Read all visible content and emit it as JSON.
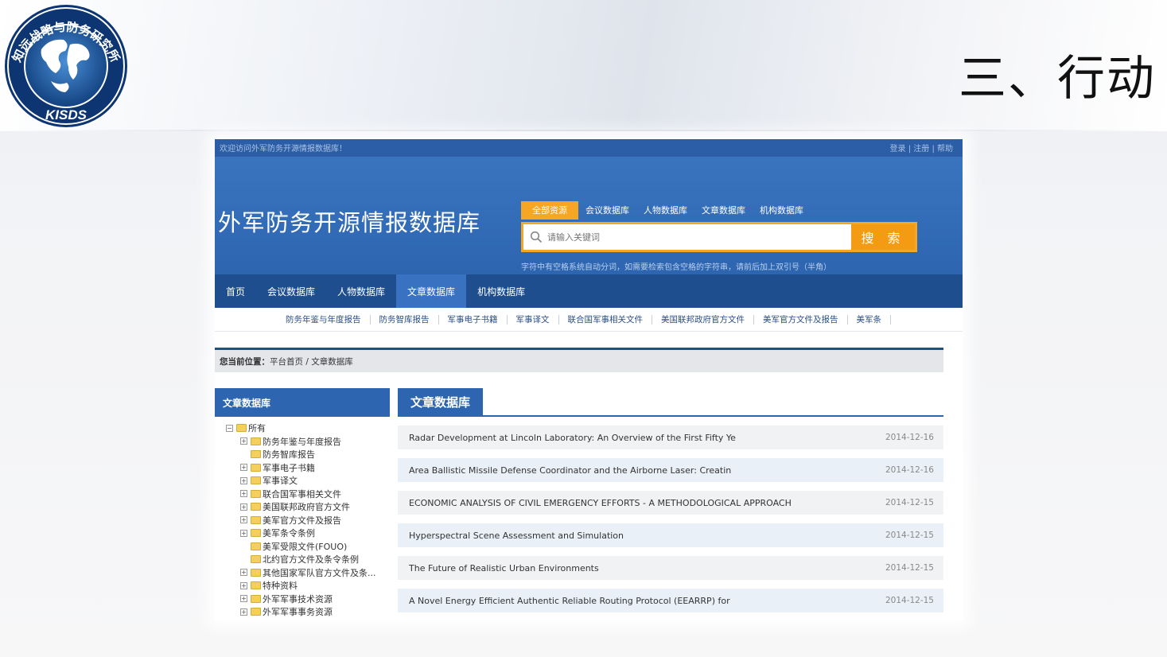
{
  "slide": {
    "title": "三、行动",
    "logo": {
      "text_top": "知远战略与防务研究所",
      "text_bottom": "KISDS"
    }
  },
  "site": {
    "topbar_left": "欢迎访问外军防务开源情报数据库！",
    "topbar_right": "登录 | 注册 | 帮助",
    "title": "外军防务开源情报数据库",
    "search_tabs": [
      "全部资源",
      "会议数据库",
      "人物数据库",
      "文章数据库",
      "机构数据库"
    ],
    "search_placeholder": "请输入关键词",
    "search_button": "搜 索",
    "search_hint": "字符中有空格系统自动分词，如需要检索包含空格的字符串，请前后加上双引号（半角）",
    "main_nav": [
      "首页",
      "会议数据库",
      "人物数据库",
      "文章数据库",
      "机构数据库"
    ],
    "main_nav_active": 3,
    "sub_nav": [
      "防务年鉴与年度报告",
      "防务智库报告",
      "军事电子书籍",
      "军事译文",
      "联合国军事相关文件",
      "美国联邦政府官方文件",
      "美军官方文件及报告",
      "美军条"
    ],
    "breadcrumb_label": "您当前位置：",
    "breadcrumb_path": "平台首页 / 文章数据库",
    "sidebar_title": "文章数据库",
    "tree_root": "所有",
    "tree_items": [
      {
        "label": "防务年鉴与年度报告",
        "expand": "+"
      },
      {
        "label": "防务智库报告",
        "expand": ""
      },
      {
        "label": "军事电子书籍",
        "expand": "+"
      },
      {
        "label": "军事译文",
        "expand": "+"
      },
      {
        "label": "联合国军事相关文件",
        "expand": "+"
      },
      {
        "label": "美国联邦政府官方文件",
        "expand": "+"
      },
      {
        "label": "美军官方文件及报告",
        "expand": "+"
      },
      {
        "label": "美军条令条例",
        "expand": "+"
      },
      {
        "label": "美军受限文件(FOUO)",
        "expand": ""
      },
      {
        "label": "北约官方文件及条令条例",
        "expand": ""
      },
      {
        "label": "其他国家军队官方文件及条...",
        "expand": "+"
      },
      {
        "label": "特种资料",
        "expand": "+"
      },
      {
        "label": "外军军事技术资源",
        "expand": "+"
      },
      {
        "label": "外军军事事务资源",
        "expand": "+"
      }
    ],
    "main_title": "文章数据库",
    "articles": [
      {
        "title": "Radar Development at Lincoln Laboratory: An Overview of the First Fifty Ye",
        "date": "2014-12-16"
      },
      {
        "title": "Area Ballistic Missile Defense Coordinator and the Airborne Laser: Creatin",
        "date": "2014-12-16"
      },
      {
        "title": "ECONOMIC ANALYSIS OF CIVIL EMERGENCY EFFORTS - A METHODOLOGICAL APPROACH",
        "date": "2014-12-15"
      },
      {
        "title": "Hyperspectral Scene Assessment and Simulation",
        "date": "2014-12-15"
      },
      {
        "title": "The Future of Realistic Urban Environments",
        "date": "2014-12-15"
      },
      {
        "title": "A Novel Energy Efficient Authentic Reliable Routing Protocol (EEARRP) for",
        "date": "2014-12-15"
      }
    ]
  },
  "colors": {
    "brand_blue": "#2d65b0",
    "nav_blue": "#1f4e8f",
    "accent_orange": "#f5a623"
  }
}
